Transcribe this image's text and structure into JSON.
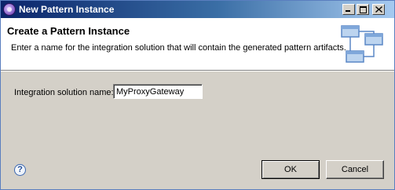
{
  "window": {
    "title": "New Pattern Instance"
  },
  "header": {
    "title": "Create a Pattern Instance",
    "description": "Enter a name for the integration solution that will contain the generated pattern artifacts."
  },
  "form": {
    "label": "Integration solution name:",
    "value": "MyProxyGateway"
  },
  "footer": {
    "help_glyph": "?",
    "ok_label": "OK",
    "cancel_label": "Cancel"
  },
  "icons": {
    "app": "pattern-app-icon",
    "banner": "pattern-diagram-icon",
    "help": "help-icon"
  },
  "colors": {
    "title_gradient_start": "#0a246a",
    "title_gradient_end": "#a6caf0",
    "dialog_background": "#d4d0c8"
  }
}
